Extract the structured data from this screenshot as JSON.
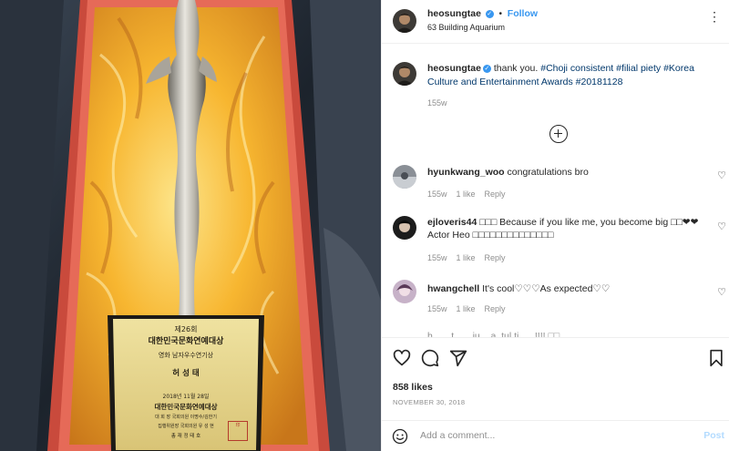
{
  "post": {
    "photo_alt": "",
    "plaque": {
      "line1": "제26회",
      "line2": "대한민국문화연예대상",
      "line3": "영화 남자우수연기상",
      "line4": "허 성 태",
      "line5": "2018년 11월 28일",
      "line6": "대한민국문화연예대상",
      "line7": "대 회 장  국회의원 이명수/김한기",
      "line8": "집행위원장 국회의원 유 성 현",
      "line9": "총  재  정 태 호",
      "seal": "印"
    }
  },
  "header": {
    "username": "heosungtae",
    "verified_glyph": "✓",
    "separator": "•",
    "follow_label": "Follow",
    "location": "63 Building Aquarium",
    "more_glyph": "⋮"
  },
  "caption": {
    "username": "heosungtae",
    "text": "thank you.",
    "hashtags": [
      "#Choji consistent",
      "#filial piety",
      "#Korea Culture and Entertainment Awards",
      "#20181128"
    ],
    "age": "155w"
  },
  "comments": [
    {
      "username": "hyunkwang_woo",
      "text": "congratulations bro",
      "age": "155w",
      "likes": "1 like",
      "reply": "Reply"
    },
    {
      "username": "ejloveris44",
      "text": "□□□ Because if you like me, you become big □□❤❤ Actor Heo □□□□□□□□□□□□□□",
      "age": "155w",
      "likes": "1 like",
      "reply": "Reply"
    },
    {
      "username": "hwangchell",
      "text": "It's cool♡♡♡As expected♡♡",
      "age": "155w",
      "likes": "1 like",
      "reply": "Reply"
    }
  ],
  "partial_comment": "h... ...t... ...iu... a..tul.ti... ..!!!! □□",
  "actions": {
    "likes": "858 likes",
    "date": "NOVEMBER 30, 2018"
  },
  "add_comment": {
    "placeholder": "Add a comment...",
    "post_label": "Post"
  },
  "icons": {
    "heart": "heart-icon",
    "comment": "comment-icon",
    "share": "share-icon",
    "save": "bookmark-icon",
    "emoji": "emoji-icon",
    "load_more": "plus-circle-icon",
    "verified": "verified-badge-icon"
  },
  "colors": {
    "link_blue": "#3897f0",
    "hashtag": "#00376b",
    "muted": "#8e8e8e",
    "satin": "#f2a51f",
    "box_red": "#d9584a",
    "plaque_gold": "#e8d58a"
  }
}
